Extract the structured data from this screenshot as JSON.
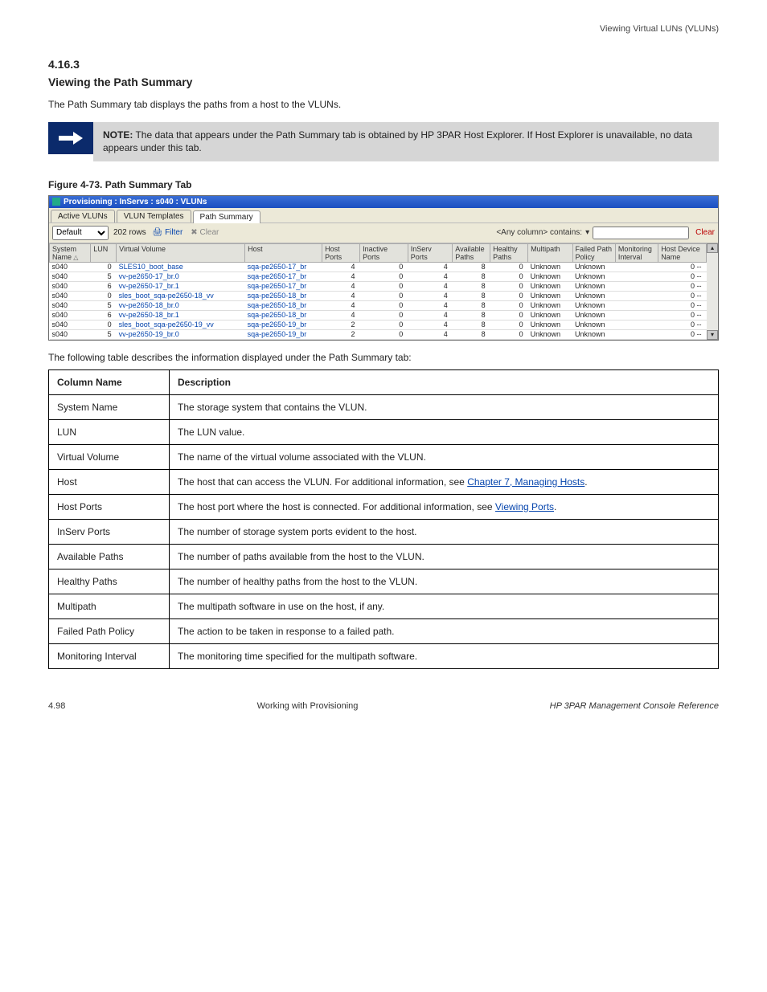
{
  "page_header": "Viewing Virtual LUNs (VLUNs)",
  "section_number": "4.16.3",
  "section_title": "Viewing the Path Summary",
  "intro_para": "The Path Summary tab displays the paths from a host to the VLUNs.",
  "note_text_prefix": "NOTE:",
  "note_text": "The data that appears under the Path Summary tab is obtained by HP 3PAR Host Explorer. If Host Explorer is unavailable, no data appears under this tab.",
  "figure_caption": "Figure 4-73.  Path Summary Tab",
  "app_titlebar": "Provisioning : InServs : s040 : VLUNs",
  "tabs": [
    {
      "label": "Active VLUNs",
      "active": false
    },
    {
      "label": "VLUN Templates",
      "active": false
    },
    {
      "label": "Path Summary",
      "active": true
    }
  ],
  "toolbar": {
    "default_label": "Default",
    "row_count": "202 rows",
    "filter_label": "Filter",
    "clear_label": "Clear",
    "contains_label": "<Any column> contains:",
    "clear2_label": "Clear"
  },
  "grid_headers": [
    "System Name",
    "LUN",
    "Virtual Volume",
    "Host",
    "Host Ports",
    "Inactive Ports",
    "InServ Ports",
    "Available Paths",
    "Healthy Paths",
    "Multipath",
    "Failed Path Policy",
    "Monitoring Interval",
    "Host Device Name"
  ],
  "grid_col_widths": [
    48,
    30,
    150,
    90,
    44,
    56,
    52,
    44,
    44,
    52,
    50,
    50,
    56
  ],
  "grid_rows": [
    [
      "s040",
      "0",
      "SLES10_boot_base",
      "sqa-pe2650-17_br",
      "4",
      "0",
      "4",
      "8",
      "0",
      "Unknown",
      "Unknown",
      "",
      "0 --"
    ],
    [
      "s040",
      "5",
      "vv-pe2650-17_br.0",
      "sqa-pe2650-17_br",
      "4",
      "0",
      "4",
      "8",
      "0",
      "Unknown",
      "Unknown",
      "",
      "0 --"
    ],
    [
      "s040",
      "6",
      "vv-pe2650-17_br.1",
      "sqa-pe2650-17_br",
      "4",
      "0",
      "4",
      "8",
      "0",
      "Unknown",
      "Unknown",
      "",
      "0 --"
    ],
    [
      "s040",
      "0",
      "sles_boot_sqa-pe2650-18_vv",
      "sqa-pe2650-18_br",
      "4",
      "0",
      "4",
      "8",
      "0",
      "Unknown",
      "Unknown",
      "",
      "0 --"
    ],
    [
      "s040",
      "5",
      "vv-pe2650-18_br.0",
      "sqa-pe2650-18_br",
      "4",
      "0",
      "4",
      "8",
      "0",
      "Unknown",
      "Unknown",
      "",
      "0 --"
    ],
    [
      "s040",
      "6",
      "vv-pe2650-18_br.1",
      "sqa-pe2650-18_br",
      "4",
      "0",
      "4",
      "8",
      "0",
      "Unknown",
      "Unknown",
      "",
      "0 --"
    ],
    [
      "s040",
      "0",
      "sles_boot_sqa-pe2650-19_vv",
      "sqa-pe2650-19_br",
      "2",
      "0",
      "4",
      "8",
      "0",
      "Unknown",
      "Unknown",
      "",
      "0 --"
    ],
    [
      "s040",
      "5",
      "vv-pe2650-19_br.0",
      "sqa-pe2650-19_br",
      "2",
      "0",
      "4",
      "8",
      "0",
      "Unknown",
      "Unknown",
      "",
      "0 --"
    ]
  ],
  "desc_intro": "The following table describes the information displayed under the Path Summary tab:",
  "desc_header": {
    "col1": "Column Name",
    "col2": "Description"
  },
  "desc_rows": [
    {
      "name": "System Name",
      "desc": "The storage system that contains the VLUN.",
      "link": null
    },
    {
      "name": "LUN",
      "desc": "The LUN value.",
      "link": null
    },
    {
      "name": "Virtual Volume",
      "desc": "The name of the virtual volume associated with the VLUN.",
      "link": null
    },
    {
      "name": "Host",
      "desc_before": "The host that can access the VLUN. For additional information, see ",
      "link": "Chapter 7, Managing Hosts",
      "desc_after": "."
    },
    {
      "name": "Host Ports",
      "desc_before": "The host port where the host is connected. For additional information, see ",
      "link": "Viewing Ports",
      "desc_after": "."
    },
    {
      "name": "InServ Ports",
      "desc": "The number of storage system ports evident to the host.",
      "link": null
    },
    {
      "name": "Available Paths",
      "desc": "The number of paths available from the host to the VLUN.",
      "link": null
    },
    {
      "name": "Healthy Paths",
      "desc": "The number of healthy paths from the host to the VLUN.",
      "link": null
    },
    {
      "name": "Multipath",
      "desc": "The multipath software in use on the host, if any.",
      "link": null
    },
    {
      "name": "Failed Path Policy",
      "desc": "The action to be taken in response to a failed path.",
      "link": null
    },
    {
      "name": "Monitoring Interval",
      "desc": "The monitoring time specified for the multipath software.",
      "link": null
    }
  ],
  "footer_left": "4.98",
  "footer_center": "Working with Provisioning",
  "footer_right": "HP 3PAR Management Console Reference"
}
